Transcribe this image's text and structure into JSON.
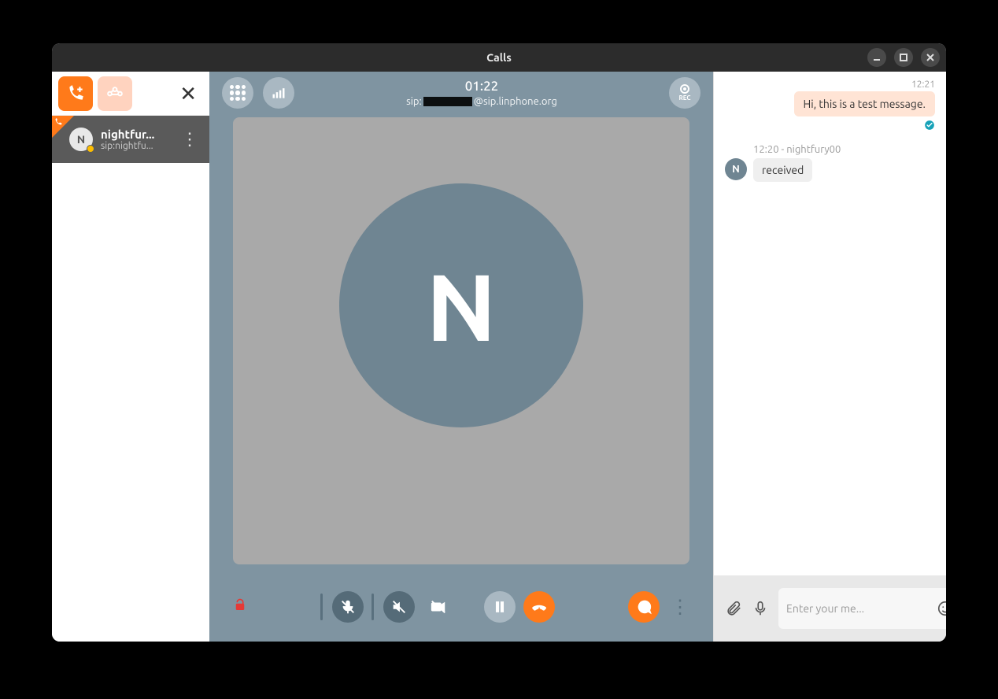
{
  "window": {
    "title": "Calls"
  },
  "sidebar": {
    "active_call": {
      "avatar_initial": "N",
      "name": "nightfur...",
      "sip": "sip:nightfu..."
    }
  },
  "call": {
    "timer": "01:22",
    "sip_prefix": "sip:",
    "sip_suffix": "@sip.linphone.org",
    "rec_label": "REC",
    "avatar_initial": "N"
  },
  "chat": {
    "out_time": "12:21",
    "out_text": "Hi, this is a test message.",
    "in_header": "12:20 - nightfury00",
    "in_avatar_initial": "N",
    "in_text": "received",
    "input_placeholder": "Enter your me..."
  }
}
